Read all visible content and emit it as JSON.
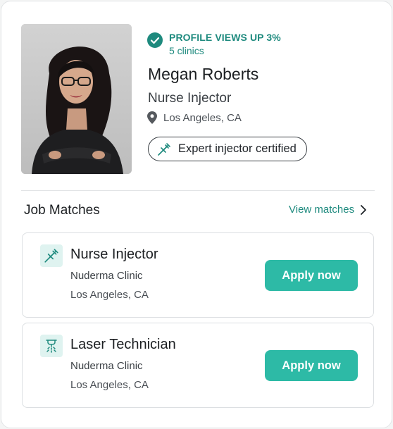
{
  "profile": {
    "views_title": "PROFILE VIEWS UP 3%",
    "views_sub": "5 clinics",
    "name": "Megan Roberts",
    "role": "Nurse Injector",
    "location": "Los Angeles, CA",
    "certification": "Expert injector certified"
  },
  "matches": {
    "title": "Job Matches",
    "view_link": "View matches",
    "jobs": [
      {
        "title": "Nurse Injector",
        "clinic": "Nuderma Clinic",
        "location": "Los Angeles, CA",
        "cta": "Apply now",
        "icon": "syringe-icon"
      },
      {
        "title": "Laser Technician",
        "clinic": "Nuderma Clinic",
        "location": "Los Angeles, CA",
        "cta": "Apply now",
        "icon": "laser-icon"
      }
    ]
  },
  "colors": {
    "accent": "#1e8a7e",
    "button": "#2dbaa6",
    "icon_bg": "#dff3f0"
  }
}
